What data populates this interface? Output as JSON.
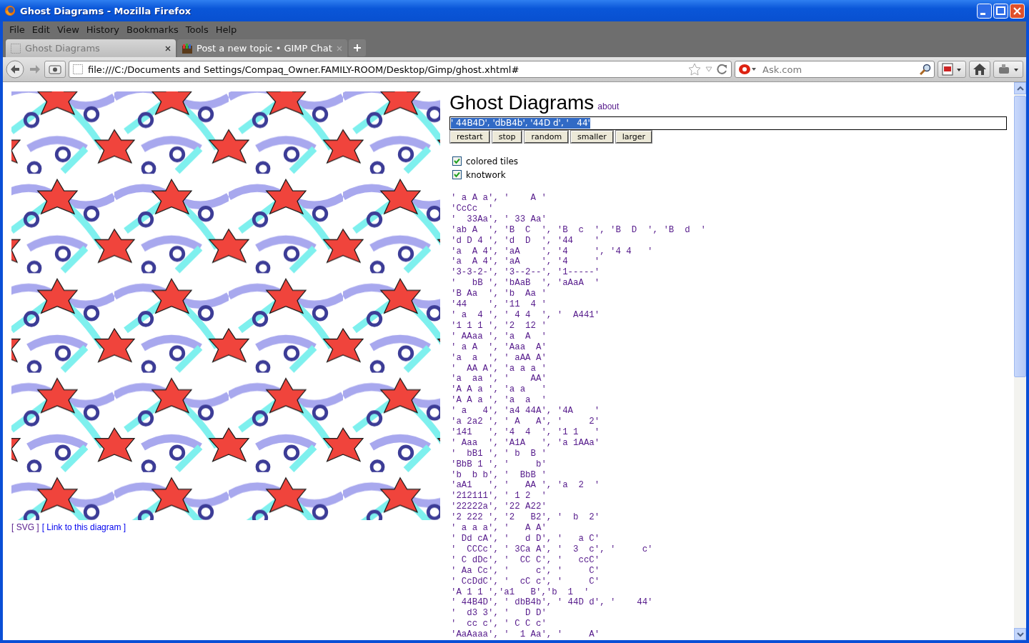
{
  "window": {
    "title": "Ghost Diagrams - Mozilla Firefox"
  },
  "menu": [
    "File",
    "Edit",
    "View",
    "History",
    "Bookmarks",
    "Tools",
    "Help"
  ],
  "tabs": [
    {
      "label": "Ghost Diagrams",
      "selected": true
    },
    {
      "label": "Post a new topic • GIMP Chat",
      "selected": false
    }
  ],
  "address_bar": {
    "url": "file:///C:/Documents and Settings/Compaq_Owner.FAMILY-ROOM/Desktop/Gimp/ghost.xhtml#"
  },
  "search": {
    "placeholder": "Ask.com"
  },
  "page": {
    "title": "Ghost Diagrams",
    "about_link": "about",
    "tiles_value": "' 44B4D', 'dbB4b', '44D d', '   44'",
    "buttons": [
      "restart",
      "stop",
      "random",
      "smaller",
      "larger"
    ],
    "options": [
      {
        "label": "colored tiles",
        "checked": true
      },
      {
        "label": "knotwork",
        "checked": true
      }
    ],
    "footer_links": [
      {
        "label": "[ SVG ]",
        "visited": true
      },
      {
        "label": "[ Link to this diagram ]",
        "visited": false
      }
    ],
    "presets": [
      "' a A a', '    A '",
      "'CcCc  '",
      "'  33Aa', ' 33 Aa'",
      "'ab A  ', 'B  C  ', 'B  c  ', 'B  D  ', 'B  d  '",
      "'d D 4 ', 'd  D  ', '44    '",
      "'a  A 4', 'aA    ', '4     ', '4 4   '",
      "'a  A 4', 'aA    ', '4     '",
      "'3-3-2-', '3--2--', '1-----'",
      "'   bB ', 'bAaB  ', 'aAaA  '",
      "'B Aa  ', 'b  Aa '",
      "'44    ', '11  4 '",
      "' a  4 ', ' 4 4  ', '  A441'",
      "'1 1 1 ', '2  12 '",
      "' AAaa ', 'a  A  '",
      "' a A  ', 'Aaa  A'",
      "'a  a  ', ' aAA A'",
      "'  AA A', 'a a a '",
      "'a  aa ', '    AA'",
      "'A A a ', 'a a   '",
      "'A A a ', 'a  a  '",
      "' a   4', 'a4 44A', '4A    '",
      "'a 2a2 ', ' A   A', '     2'",
      "'141   ', '4  4  ', '1 1   '",
      "' Aaa  ', 'A1A   ', 'a 1AAa'",
      "'  bB1 ', ' b  B '",
      "'BbB 1 ', '     b'",
      "'b  b b', '  BbB '",
      "'aA1   ', '   AA ', 'a  2  '",
      "'212111', ' 1 2  '",
      "'22222a', '22 A22'",
      "'2 222 ', '2   B2', '  b  2'",
      "' a a a', '   A A'",
      "' Dd cA', '   d D', '   a C'",
      "'  CCCc', ' 3Ca A', '  3  c', '     c'",
      "' C dDc', '  CC C', '   ccC'",
      "' Aa Cc', '     c', '     C'",
      "' CcDdC', '  cC c', '     C'",
      "'A 1 1 ','a1   B','b  1  '",
      "' 44B4D', ' dbB4b', ' 44D d', '    44'",
      "'  d3 3', '   D D'",
      "'  cc c', ' C C c'",
      "'AaAaaa', '  1 Aa', '     A'"
    ]
  }
}
